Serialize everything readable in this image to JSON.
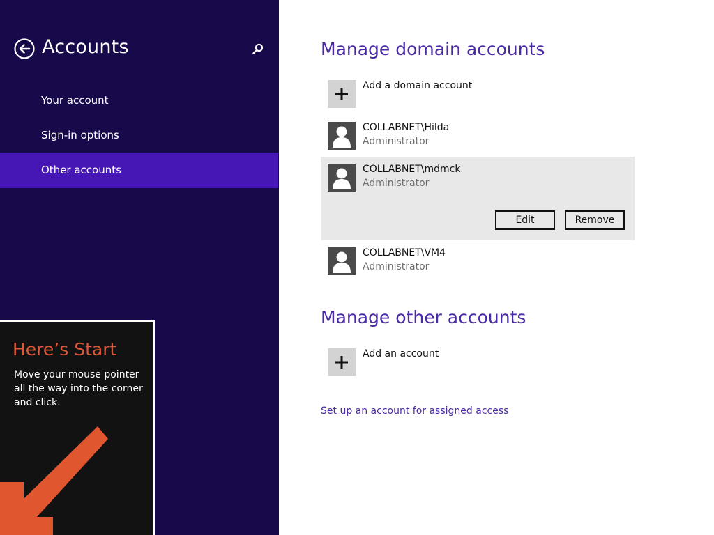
{
  "sidebar": {
    "title": "Accounts",
    "items": [
      {
        "label": "Your account"
      },
      {
        "label": "Sign-in options"
      },
      {
        "label": "Other accounts"
      }
    ]
  },
  "tip": {
    "title": "Here’s Start",
    "body": "Move your mouse pointer all the way into the corner and click."
  },
  "domain_section": {
    "title": "Manage domain accounts",
    "add_label": "Add a domain account",
    "accounts": [
      {
        "name": "COLLABNET\\Hilda",
        "role": "Administrator"
      },
      {
        "name": "COLLABNET\\mdmck",
        "role": "Administrator"
      },
      {
        "name": "COLLABNET\\VM4",
        "role": "Administrator"
      }
    ],
    "edit_label": "Edit",
    "remove_label": "Remove"
  },
  "other_section": {
    "title": "Manage other accounts",
    "add_label": "Add an account",
    "assigned_access_link": "Set up an account for assigned access"
  },
  "colors": {
    "sidebar_bg": "#180a4a",
    "selected_item": "#4617b4",
    "accent_text": "#4b2aa5",
    "tip_title": "#e0563a",
    "arrow": "#e0562f"
  }
}
